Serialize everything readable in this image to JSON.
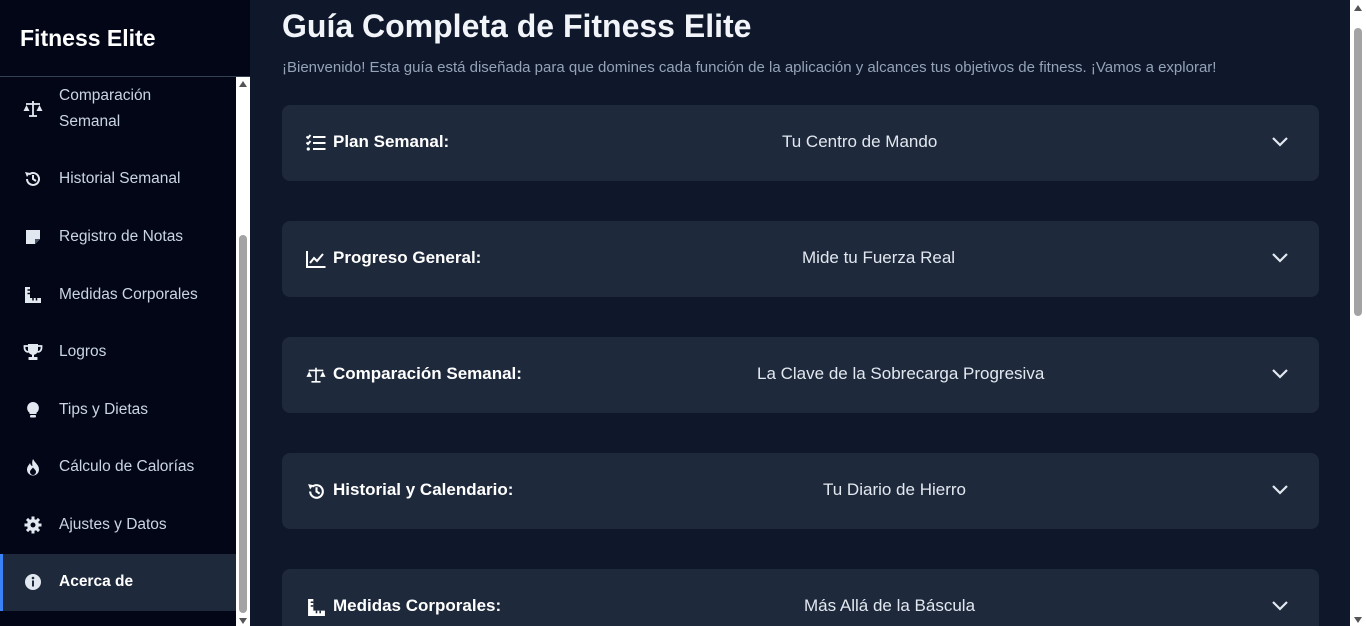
{
  "app": {
    "title": "Fitness Elite"
  },
  "sidebar": {
    "items": [
      {
        "label_line1": "Comparación",
        "label_line2": "Semanal",
        "icon": "scale-icon"
      },
      {
        "label": "Historial Semanal",
        "icon": "history-icon"
      },
      {
        "label": "Registro de Notas",
        "icon": "note-icon"
      },
      {
        "label": "Medidas Corporales",
        "icon": "ruler-icon"
      },
      {
        "label": "Logros",
        "icon": "trophy-icon"
      },
      {
        "label": "Tips y Dietas",
        "icon": "lightbulb-icon"
      },
      {
        "label": "Cálculo de Calorías",
        "icon": "fire-icon"
      },
      {
        "label": "Ajustes y Datos",
        "icon": "gear-icon"
      },
      {
        "label": "Acerca de",
        "icon": "info-icon",
        "active": true
      }
    ]
  },
  "main": {
    "title": "Guía Completa de Fitness Elite",
    "intro": "¡Bienvenido! Esta guía está diseñada para que domines cada función de la aplicación y alcances tus objetivos de fitness. ¡Vamos a explorar!",
    "sections": [
      {
        "title": "Plan Semanal:",
        "subtitle": "Tu Centro de Mando",
        "icon": "list-check-icon"
      },
      {
        "title": "Progreso General:",
        "subtitle": "Mide tu Fuerza Real",
        "icon": "chart-line-icon"
      },
      {
        "title": "Comparación Semanal:",
        "subtitle": "La Clave de la Sobrecarga Progresiva",
        "icon": "scale-icon"
      },
      {
        "title": "Historial y Calendario:",
        "subtitle": "Tu Diario de Hierro",
        "icon": "history-icon"
      },
      {
        "title": "Medidas Corporales:",
        "subtitle": "Más Allá de la Báscula",
        "icon": "ruler-icon"
      }
    ]
  },
  "colors": {
    "sidebar_bg": "#020617",
    "main_bg": "#0f172a",
    "card_bg": "#1e293b",
    "accent": "#3b82f6"
  }
}
